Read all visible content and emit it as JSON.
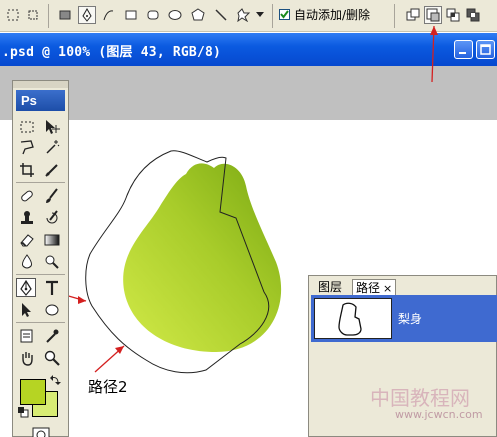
{
  "options_bar": {
    "auto_add_delete_label": "自动添加/删除",
    "auto_add_delete_checked": true
  },
  "document": {
    "title": ".psd @ 100% (图层 43, RGB/8)"
  },
  "toolbox": {
    "logo": "Ps",
    "foreground_color": "#b6d423",
    "background_color": "#d8ec74"
  },
  "paths_panel": {
    "tabs": [
      {
        "label": "图层"
      },
      {
        "label": "路径"
      }
    ],
    "close_glyph": "×",
    "paths": [
      {
        "name": "梨身"
      }
    ]
  },
  "annotation": {
    "label": "路径2"
  },
  "watermark": {
    "title": "中国教程网",
    "url": "www.jcwcn.com"
  },
  "colors": {
    "pear_light": "#d2ea48",
    "pear_dark": "#79a812",
    "annotation_arrow": "#d42020",
    "titlebar_blue": "#0b5ae0"
  }
}
